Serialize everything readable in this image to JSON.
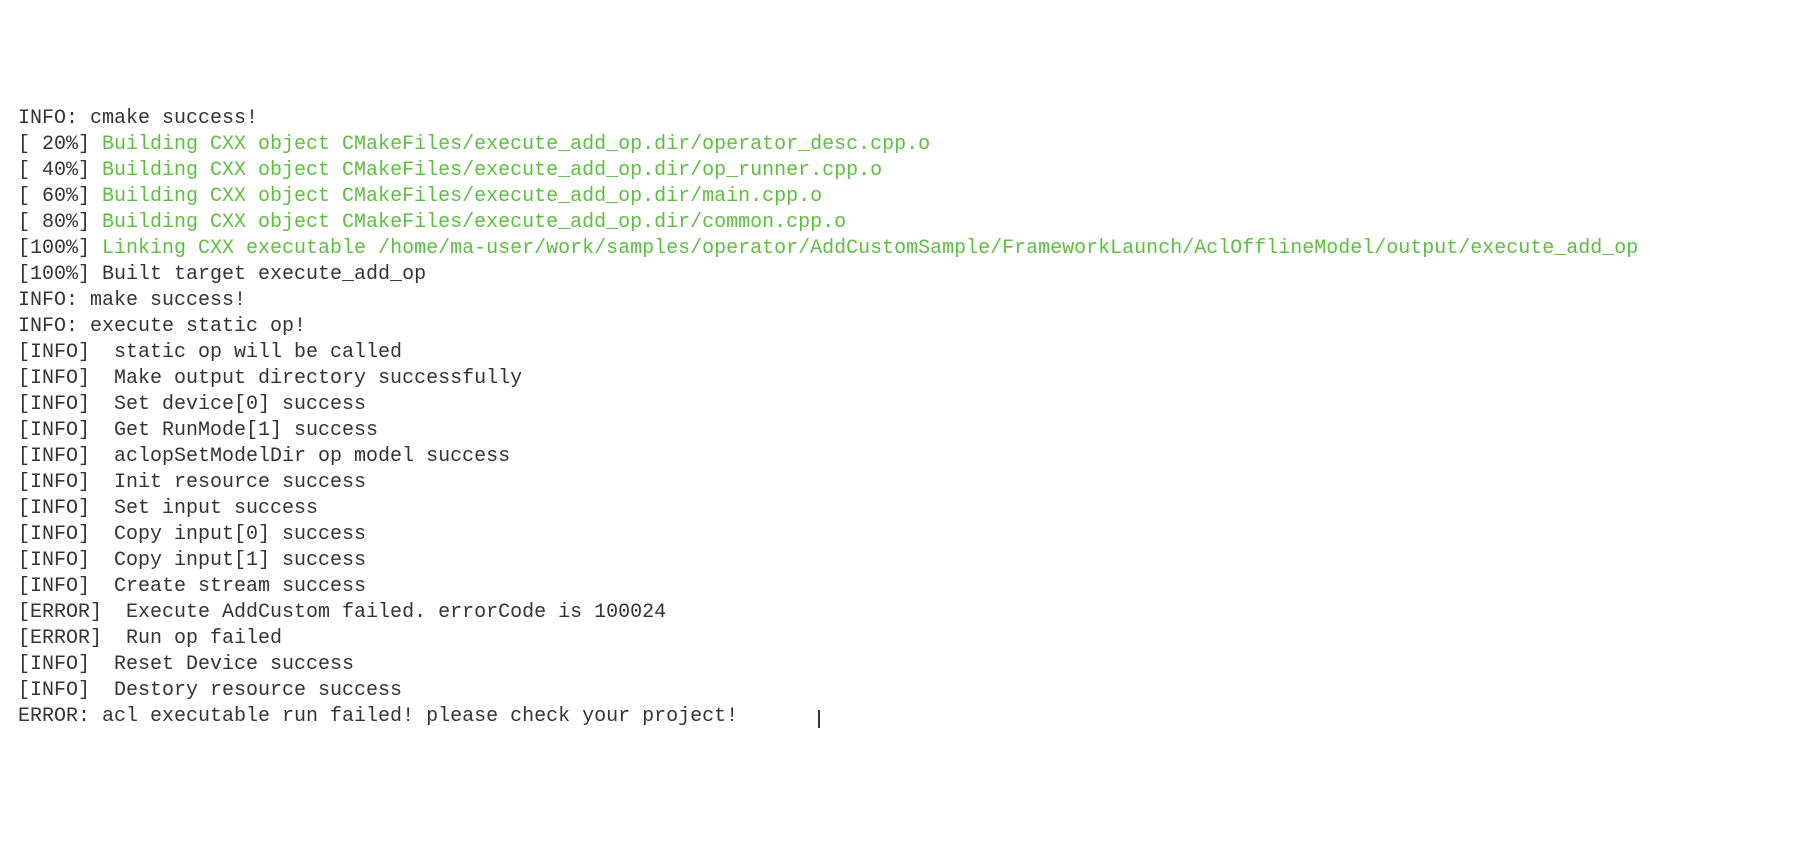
{
  "lines": [
    {
      "type": "plain",
      "text": "INFO: cmake success!"
    },
    {
      "type": "build",
      "percent": "[ 20%] ",
      "text": "Building CXX object CMakeFiles/execute_add_op.dir/operator_desc.cpp.o"
    },
    {
      "type": "build",
      "percent": "[ 40%] ",
      "text": "Building CXX object CMakeFiles/execute_add_op.dir/op_runner.cpp.o"
    },
    {
      "type": "build",
      "percent": "[ 60%] ",
      "text": "Building CXX object CMakeFiles/execute_add_op.dir/main.cpp.o"
    },
    {
      "type": "build",
      "percent": "[ 80%] ",
      "text": "Building CXX object CMakeFiles/execute_add_op.dir/common.cpp.o"
    },
    {
      "type": "link",
      "percent": "[100%] ",
      "text": "Linking CXX executable /home/ma-user/work/samples/operator/AddCustomSample/FrameworkLaunch/AclOfflineModel/output/execute_add_op"
    },
    {
      "type": "plain",
      "text": "[100%] Built target execute_add_op"
    },
    {
      "type": "plain",
      "text": "INFO: make success!"
    },
    {
      "type": "plain",
      "text": "INFO: execute static op!"
    },
    {
      "type": "plain",
      "text": "[INFO]  static op will be called"
    },
    {
      "type": "plain",
      "text": "[INFO]  Make output directory successfully"
    },
    {
      "type": "plain",
      "text": "[INFO]  Set device[0] success"
    },
    {
      "type": "plain",
      "text": "[INFO]  Get RunMode[1] success"
    },
    {
      "type": "plain",
      "text": "[INFO]  aclopSetModelDir op model success"
    },
    {
      "type": "plain",
      "text": "[INFO]  Init resource success"
    },
    {
      "type": "plain",
      "text": "[INFO]  Set input success"
    },
    {
      "type": "plain",
      "text": "[INFO]  Copy input[0] success"
    },
    {
      "type": "plain",
      "text": "[INFO]  Copy input[1] success"
    },
    {
      "type": "plain",
      "text": "[INFO]  Create stream success"
    },
    {
      "type": "plain",
      "text": "[ERROR]  Execute AddCustom failed. errorCode is 100024"
    },
    {
      "type": "plain",
      "text": "[ERROR]  Run op failed"
    },
    {
      "type": "plain",
      "text": "[INFO]  Reset Device success"
    },
    {
      "type": "plain",
      "text": "[INFO]  Destory resource success"
    },
    {
      "type": "plain_cursor",
      "text": "ERROR: acl executable run failed! please check your project!"
    }
  ]
}
